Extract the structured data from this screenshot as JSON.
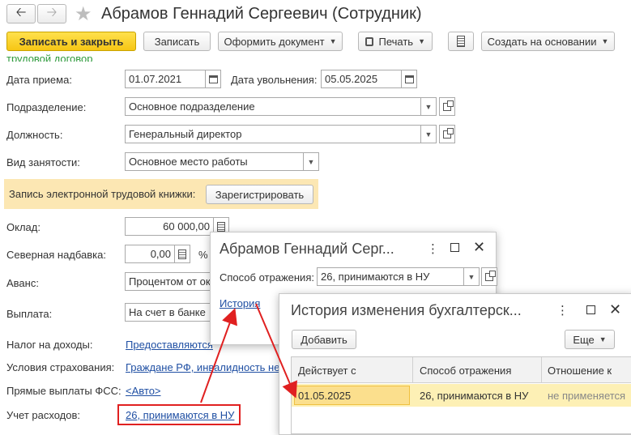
{
  "header": {
    "title": "Абрамов Геннадий Сергеевич (Сотрудник)"
  },
  "toolbar": {
    "save_close": "Записать и закрыть",
    "save": "Записать",
    "make_doc": "Оформить документ",
    "print": "Печать",
    "create_based": "Создать на основании"
  },
  "form": {
    "section": "Трудовой договор",
    "hire_date_label": "Дата приема:",
    "hire_date": "01.07.2021",
    "dismissal_label": "Дата увольнения:",
    "dismissal_date": "05.05.2025",
    "dept_label": "Подразделение:",
    "dept": "Основное подразделение",
    "position_label": "Должность:",
    "position": "Генеральный директор",
    "employment_label": "Вид занятости:",
    "employment": "Основное место работы",
    "etk_label": "Запись электронной трудовой книжки:",
    "etk_button": "Зарегистрировать",
    "salary_label": "Оклад:",
    "salary": "60 000,00",
    "north_label": "Северная надбавка:",
    "north": "0,00",
    "north_unit": "%",
    "advance_label": "Аванс:",
    "advance": "Процентом от окл",
    "payout_label": "Выплата:",
    "payout": "На счет в банке",
    "tax_label": "Налог на доходы:",
    "tax_link": "Предоставляются",
    "insurance_label": "Условия страхования:",
    "insurance_link": "Граждане РФ, инвалидность не",
    "fss_label": "Прямые выплаты ФСС:",
    "fss_link": "<Авто>",
    "expense_label": "Учет расходов:",
    "expense_link": "26, принимаются в НУ"
  },
  "dialog1": {
    "title": "Абрамов Геннадий Серг...",
    "method_label": "Способ отражения:",
    "method": "26, принимаются в НУ",
    "history_link": "История"
  },
  "dialog2": {
    "title": "История изменения бухгалтерск...",
    "add_button": "Добавить",
    "more_button": "Еще",
    "columns": [
      "Действует с",
      "Способ отражения",
      "Отношение к"
    ],
    "row": {
      "date": "01.05.2025",
      "method": "26, принимаются в НУ",
      "relation": "не применяется"
    }
  },
  "colors": {
    "primary_button": "#f6c614",
    "section_green": "#2e9a3c",
    "highlight_box": "#fce7b3",
    "annotation_red": "#e02020",
    "link_blue": "#1f4fa3",
    "selected_row": "#fdf0b5"
  },
  "icons": [
    "back-arrow-icon",
    "forward-arrow-icon",
    "star-icon",
    "printer-icon",
    "report-icon",
    "calendar-icon",
    "calculator-icon",
    "open-icon",
    "dropdown-icon",
    "minimize-icon",
    "maximize-icon",
    "close-icon"
  ]
}
